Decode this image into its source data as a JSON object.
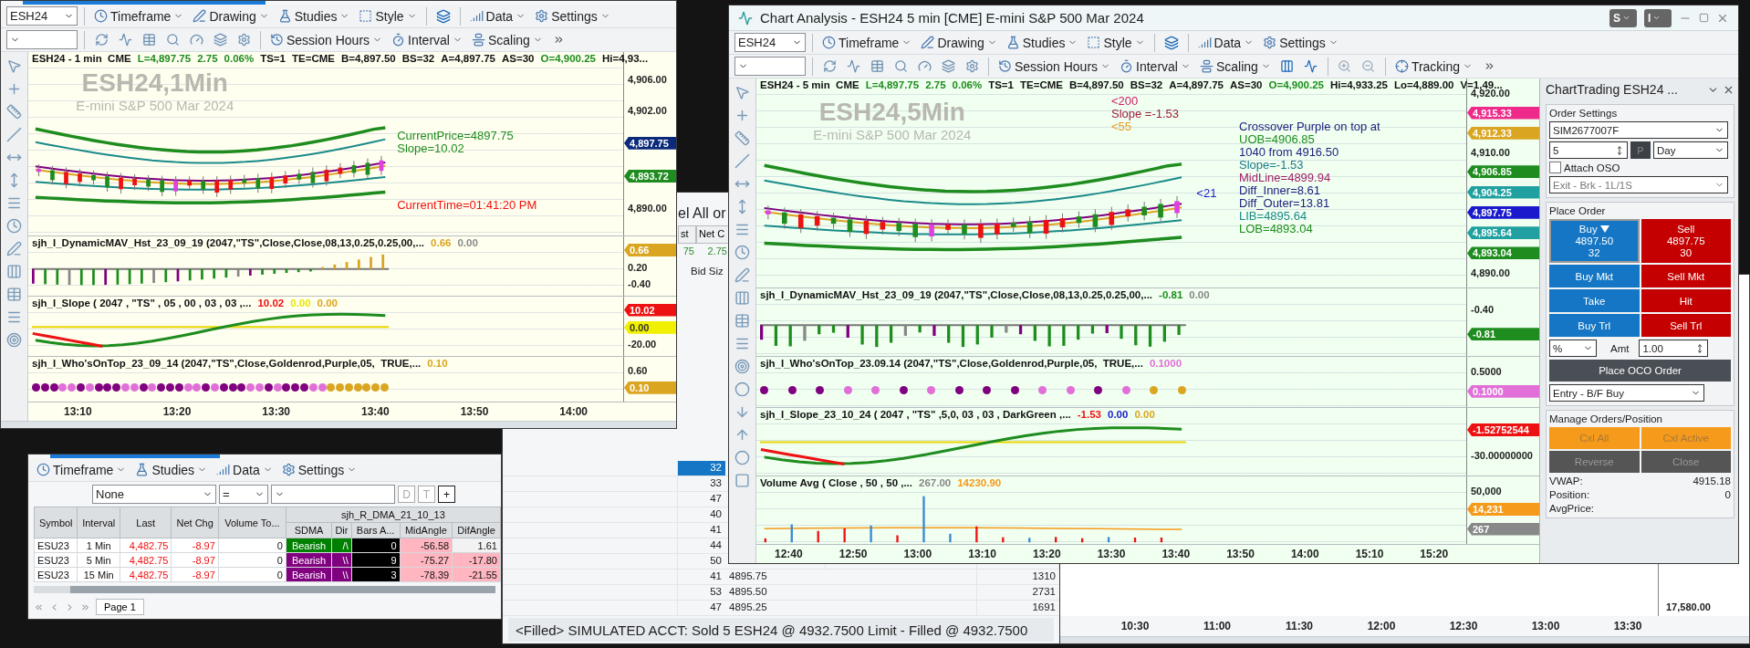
{
  "left_chart": {
    "symbol": "ESH24",
    "menus": [
      {
        "label": "Timeframe",
        "kind": "timeframe"
      },
      {
        "label": "Drawing",
        "kind": "drawing"
      },
      {
        "label": "Studies",
        "kind": "studies"
      },
      {
        "label": "Style",
        "kind": "style"
      },
      {
        "label": "Data",
        "kind": "data"
      },
      {
        "label": "Settings",
        "kind": "settings"
      }
    ],
    "menus2": [
      {
        "label": "Session Hours",
        "kind": "session"
      },
      {
        "label": "Interval",
        "kind": "interval"
      },
      {
        "label": "Scaling",
        "kind": "scaling"
      }
    ],
    "panels": [
      {
        "kind": "price",
        "title": "ESH24 - 1 min  CME",
        "values": [
          {
            "text": "L=4,897.75",
            "color": "#1e8c1e"
          },
          {
            "text": "2.75",
            "color": "#1e8c1e"
          },
          {
            "text": "0.06%",
            "color": "#1e8c1e"
          },
          {
            "text": "TS=1"
          },
          {
            "text": "TE=CME"
          },
          {
            "text": "B=4,897.50"
          },
          {
            "text": "BS=32"
          },
          {
            "text": "A=4,897.75"
          },
          {
            "text": "AS=30"
          },
          {
            "text": "O=4,900.25",
            "color": "#1e8c1e"
          },
          {
            "text": "Hi=4,93..."
          }
        ],
        "watermark": {
          "title": "ESH24,1Min",
          "subtitle": "E-mini S&P 500 Mar 2024"
        },
        "annotations": [
          {
            "lines": [
              {
                "text": "CurrentPrice=4897.75",
                "color": "#1e8c1e"
              },
              {
                "text": "Slope=10.02",
                "color": "#1e8c1e"
              }
            ]
          },
          {
            "lines": [
              {
                "text": "CurrentTime=01:41:20 PM",
                "color": "#ee1111"
              }
            ]
          }
        ],
        "axis": [
          {
            "text": "4,906.00"
          },
          {
            "text": "4,902.00"
          },
          {
            "text": "4,897.75",
            "color": "#0b2a7a"
          },
          {
            "text": "4,893.72",
            "color": "#1e8c1e"
          },
          {
            "text": "4,890.00"
          }
        ]
      },
      {
        "kind": "histogram",
        "title": "sjh_I_DynamicMAV_Hst_23_09_19 (2047,\"TS\",Close,Close,08,13,0.25,0.25,00,...",
        "values": [
          {
            "text": "0.66",
            "color": "#daa520"
          },
          {
            "text": "0.00",
            "color": "#888888"
          }
        ],
        "axis": [
          {
            "text": "0.66",
            "color": "#daa520"
          },
          {
            "text": "0.20"
          },
          {
            "text": "-0.40"
          }
        ]
      },
      {
        "kind": "line",
        "title": "sjh_I_Slope ( 2047 , \"TS\" , 05 , 00 , 03 , 03 ,...",
        "values": [
          {
            "text": "10.02",
            "color": "#ee1111"
          },
          {
            "text": "0.00",
            "color": "#e8e800"
          },
          {
            "text": "0.00",
            "color": "#daa520"
          }
        ],
        "axis": [
          {
            "text": "10.02",
            "color": "#ee1111"
          },
          {
            "text": "0.00",
            "color": "#f0f000"
          },
          {
            "text": "-20.00"
          }
        ]
      },
      {
        "kind": "dots",
        "title": "sjh_I_Who'sOnTop_23_09_14 (2047,\"TS\",Close,Goldenrod,Purple,05,  TRUE,...",
        "values": [
          {
            "text": "0.10",
            "color": "#daa520"
          }
        ],
        "axis": [
          {
            "text": "0.60"
          },
          {
            "text": "0.10",
            "color": "#daa520"
          }
        ]
      }
    ],
    "time_axis": [
      "13:10",
      "13:20",
      "13:30",
      "13:40",
      "13:50",
      "14:00"
    ]
  },
  "chart_window": {
    "title": "Chart Analysis - ESH24 5 min [CME] E-mini S&P 500 Mar 2024",
    "title_buttons": [
      "S",
      "I"
    ],
    "symbol": "ESH24",
    "menus": [
      {
        "label": "Timeframe",
        "kind": "timeframe"
      },
      {
        "label": "Drawing",
        "kind": "drawing"
      },
      {
        "label": "Studies",
        "kind": "studies"
      },
      {
        "label": "Style",
        "kind": "style"
      },
      {
        "label": "Data",
        "kind": "data"
      },
      {
        "label": "Settings",
        "kind": "settings"
      }
    ],
    "menus2": [
      {
        "label": "Session Hours",
        "kind": "session"
      },
      {
        "label": "Interval",
        "kind": "interval"
      },
      {
        "label": "Scaling",
        "kind": "scaling"
      },
      {
        "label": "Tracking",
        "kind": "tracking"
      }
    ],
    "panels": [
      {
        "kind": "price",
        "title": "ESH24 - 5 min  CME",
        "values": [
          {
            "text": "L=4,897.75",
            "color": "#1e8c1e"
          },
          {
            "text": "2.75",
            "color": "#1e8c1e"
          },
          {
            "text": "0.06%",
            "color": "#1e8c1e"
          },
          {
            "text": "TS=1"
          },
          {
            "text": "TE=CME"
          },
          {
            "text": "B=4,897.50"
          },
          {
            "text": "BS=32"
          },
          {
            "text": "A=4,897.75"
          },
          {
            "text": "AS=30"
          },
          {
            "text": "O=4,900.25",
            "color": "#1e8c1e"
          },
          {
            "text": "Hi=4,933.25"
          },
          {
            "text": "Lo=4,889.00"
          },
          {
            "text": "V=1,49..."
          }
        ],
        "watermark": {
          "title": "ESH24,5Min",
          "subtitle": "E-mini S&P 500 Mar 2024"
        },
        "annotations": [
          {
            "lines": [
              {
                "text": "<200",
                "color": "#d0206a"
              },
              {
                "text": "Slope =-1.53",
                "color": "#a02040"
              },
              {
                "text": "<55",
                "color": "#e89a20"
              }
            ]
          },
          {
            "lines": [
              {
                "text": "<21",
                "color": "#1a1acc"
              }
            ]
          },
          {
            "lines": [
              {
                "text": "Crossover Purple on top at",
                "color": "#202080"
              },
              {
                "text": "UOB=4906.85",
                "color": "#1e8c1e"
              },
              {
                "text": "1040 from 4916.50",
                "color": "#202080"
              },
              {
                "text": "Slope=-1.53",
                "color": "#1a7a8a"
              },
              {
                "text": "MidLine=4899.94",
                "color": "#a0206a"
              },
              {
                "text": "Diff_Inner=8.61",
                "color": "#202080"
              },
              {
                "text": "Diff_Outer=13.81",
                "color": "#202080"
              },
              {
                "text": "LIB=4895.64",
                "color": "#1a8a8a"
              },
              {
                "text": "LOB=4893.04",
                "color": "#1e8c1e"
              }
            ]
          }
        ],
        "axis": [
          {
            "text": "4,920.00"
          },
          {
            "text": "4,915.33",
            "color": "#ee2a8a"
          },
          {
            "text": "4,912.33",
            "color": "#daa520"
          },
          {
            "text": "4,910.00"
          },
          {
            "text": "4,906.85",
            "color": "#1e8c1e"
          },
          {
            "text": "4,904.25",
            "color": "#20a0a0"
          },
          {
            "text": "4,897.75",
            "color": "#1a1acc"
          },
          {
            "text": "4,895.64",
            "color": "#20a0a0"
          },
          {
            "text": "4,893.04",
            "color": "#1e8c1e"
          },
          {
            "text": "4,890.00"
          }
        ]
      },
      {
        "kind": "histogram",
        "title": "sjh_I_DynamicMAV_Hst_23_09_19 (2047,\"TS\",Close,Close,08,13,0.25,0.25,00,...",
        "values": [
          {
            "text": "-0.81",
            "color": "#1e8c1e"
          },
          {
            "text": "0.00",
            "color": "#888888"
          }
        ],
        "axis": [
          {
            "text": "-0.40"
          },
          {
            "text": "-0.81",
            "color": "#1e8c1e"
          }
        ]
      },
      {
        "kind": "dots",
        "title": "sjh_I_Who'sOnTop_23.09.14 (2047,\"TS\",Close,Goldenrod,Purple,05,  TRUE,...",
        "values": [
          {
            "text": "0.1000",
            "color": "#e070d8"
          }
        ],
        "axis": [
          {
            "text": "0.5000"
          },
          {
            "text": "0.1000",
            "color": "#e070d8"
          }
        ]
      },
      {
        "kind": "line",
        "title": "sjh_I_Slope_23_10_24 ( 2047 , \"TS\" ,5,0, 03 , 03 , DarkGreen ,...",
        "values": [
          {
            "text": "-1.53",
            "color": "#ee1111"
          },
          {
            "text": "0.00",
            "color": "#1a1acc"
          },
          {
            "text": "0.00",
            "color": "#daa520"
          }
        ],
        "axis": [
          {
            "text": "-1.52752544",
            "color": "#ee1111"
          },
          {
            "text": "-30.00000000"
          }
        ]
      },
      {
        "kind": "volume",
        "title": "Volume Avg ( Close , 50 , 50 ,...",
        "values": [
          {
            "text": "267.00",
            "color": "#888888"
          },
          {
            "text": "14230.90",
            "color": "#f59a1a"
          }
        ],
        "axis": [
          {
            "text": "50,000"
          },
          {
            "text": "14,231",
            "color": "#f59a1a"
          },
          {
            "text": "267",
            "color": "#888888"
          }
        ]
      }
    ],
    "time_axis": [
      "12:40",
      "12:50",
      "13:00",
      "13:10",
      "13:20",
      "13:30",
      "13:40",
      "13:50",
      "14:00",
      "15:10",
      "15:20"
    ]
  },
  "chart_trading": {
    "title": "ChartTrading ESH24 ...",
    "order_settings": {
      "legend": "Order Settings",
      "account": "SIM2677007F",
      "quantity": "5",
      "price_button": "P",
      "tif": "Day",
      "attach_oso": {
        "label": "Attach OSO",
        "checked": false
      },
      "strategy": "Exit - Brk - 1L/1S"
    },
    "place_order": {
      "legend": "Place Order",
      "buy": {
        "label": "Buy",
        "price": "4897.50",
        "size": "32"
      },
      "sell": {
        "label": "Sell",
        "price": "4897.75",
        "size": "30"
      },
      "buttons": [
        {
          "label": "Buy Mkt",
          "kind": "buy"
        },
        {
          "label": "Sell Mkt",
          "kind": "sell"
        },
        {
          "label": "Take",
          "kind": "buy"
        },
        {
          "label": "Hit",
          "kind": "sell"
        },
        {
          "label": "Buy Trl",
          "kind": "buy"
        },
        {
          "label": "Sell Trl",
          "kind": "sell"
        }
      ],
      "offset_type": "%",
      "amount_label": "Amt",
      "amount": "1.00",
      "oco_button": "Place OCO Order",
      "entry": "Entry - B/F Buy"
    },
    "manage": {
      "legend": "Manage Orders/Position",
      "buttons": [
        {
          "label": "Cxl All",
          "kind": "cancel",
          "disabled": true
        },
        {
          "label": "Cxl Active",
          "kind": "cancel",
          "disabled": true
        },
        {
          "label": "Reverse",
          "kind": "position",
          "disabled": true
        },
        {
          "label": "Close",
          "kind": "position",
          "disabled": true
        }
      ]
    },
    "stats": [
      {
        "label": "VWAP:",
        "value": "4915.18"
      },
      {
        "label": "Position:",
        "value": "0"
      },
      {
        "label": "AvgPrice:"
      }
    ]
  },
  "grid_window": {
    "menus": [
      {
        "label": "Timeframe",
        "kind": "timeframe"
      },
      {
        "label": "Studies",
        "kind": "studies"
      },
      {
        "label": "Data",
        "kind": "data"
      },
      {
        "label": "Settings",
        "kind": "settings"
      }
    ],
    "filters": [
      "None",
      "="
    ],
    "filter_buttons": [
      {
        "label": "D",
        "disabled": true
      },
      {
        "label": "T",
        "disabled": true
      },
      {
        "label": "+",
        "disabled": false
      }
    ],
    "columns": [
      "Symbol",
      "Interval",
      "Last",
      "Net Chg",
      "Volume To..."
    ],
    "group_header": "sjh_R_DMA_21_10_13",
    "group_columns": [
      "SDMA",
      "Dir",
      "Bars A...",
      "MidAngle",
      "DifAngle"
    ],
    "rows": [
      {
        "symbol": "ESU23",
        "interval": "1 Min",
        "last": "4,482.75",
        "net_chg": "-8.97",
        "volume": "0",
        "sdma": "Bearish",
        "dir": "/\\",
        "bars": "0",
        "mid_angle": "-56.58",
        "dif_angle": "1.61",
        "color": "#008000",
        "dif_highlight": false
      },
      {
        "symbol": "ESU23",
        "interval": "5 Min",
        "last": "4,482.75",
        "net_chg": "-8.97",
        "volume": "0",
        "sdma": "Bearish",
        "dir": "\\\\",
        "bars": "9",
        "mid_angle": "-75.27",
        "dif_angle": "-17.80",
        "color": "#800080",
        "dif_highlight": true
      },
      {
        "symbol": "ESU23",
        "interval": "15 Min",
        "last": "4,482.75",
        "net_chg": "-8.97",
        "volume": "0",
        "sdma": "Bearish",
        "dir": "\\\\",
        "bars": "3",
        "mid_angle": "-78.39",
        "dif_angle": "-21.55",
        "color": "#800080",
        "dif_highlight": true
      }
    ],
    "page_tab": "Page 1"
  },
  "order_window": {
    "title_fragment": "el All or",
    "columns": [
      "st",
      "Net C"
    ],
    "quote": [
      "75",
      "2.75"
    ],
    "ladder_header": "Bid Siz",
    "ladder": [
      {
        "bid_size": "32",
        "selected": true
      },
      {
        "bid_size": "33",
        "selected": false
      },
      {
        "bid_size": "47",
        "selected": false
      },
      {
        "bid_size": "40",
        "selected": false
      },
      {
        "bid_size": "41",
        "selected": false
      },
      {
        "bid_size": "44",
        "selected": false
      },
      {
        "bid_size": "50",
        "selected": false
      },
      {
        "bid_size": "41",
        "price": "4895.75",
        "volume": "1310",
        "selected": false
      },
      {
        "bid_size": "53",
        "price": "4895.50",
        "volume": "2731",
        "selected": false
      },
      {
        "bid_size": "47",
        "price": "4895.25",
        "volume": "1691",
        "selected": false
      }
    ],
    "status": "<Filled> SIMULATED ACCT: Sold 5 ESH24 @ 4932.7500 Limit - Filled @ 4932.7500"
  },
  "background_chart": {
    "price_axis": [
      "17,580.00"
    ],
    "time_axis": [
      "10:30",
      "11:00",
      "11:30",
      "12:00",
      "12:30",
      "13:00",
      "13:30"
    ]
  }
}
